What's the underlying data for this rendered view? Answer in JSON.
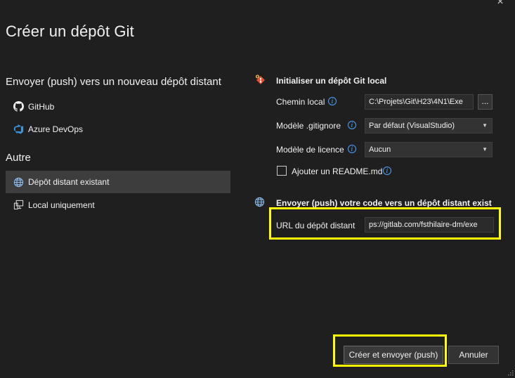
{
  "dialog": {
    "title": "Créer un dépôt Git",
    "close_glyph": "×"
  },
  "sidebar": {
    "push_heading": "Envoyer (push) vers un nouveau dépôt distant",
    "push_items": [
      {
        "label": "GitHub",
        "icon": "github-icon"
      },
      {
        "label": "Azure DevOps",
        "icon": "azure-devops-icon"
      }
    ],
    "other_heading": "Autre",
    "other_items": [
      {
        "label": "Dépôt distant existant",
        "icon": "globe-icon",
        "selected": true
      },
      {
        "label": "Local uniquement",
        "icon": "computer-icon",
        "selected": false
      }
    ]
  },
  "init_section": {
    "heading": "Initialiser un dépôt Git local",
    "local_path_label": "Chemin local",
    "local_path_value": "C:\\Projets\\Git\\H23\\4N1\\Exe",
    "browse_label": "...",
    "gitignore_label": "Modèle .gitignore",
    "gitignore_value": "Par défaut (VisualStudio)",
    "license_label": "Modèle de licence",
    "license_value": "Aucun",
    "readme_label": "Ajouter un README.md",
    "readme_checked": false
  },
  "push_section": {
    "heading": "Envoyer (push) votre code vers un dépôt distant exista",
    "url_label": "URL du dépôt distant",
    "url_value": "ps://gitlab.com/fsthilaire-dm/exe"
  },
  "footer": {
    "create_push_label": "Créer et envoyer (push)",
    "cancel_label": "Annuler"
  },
  "colors": {
    "background": "#1f1f1f",
    "highlight": "#ffff00",
    "info_blue": "#4aa3ff",
    "selected_bg": "#3d3d3d"
  }
}
